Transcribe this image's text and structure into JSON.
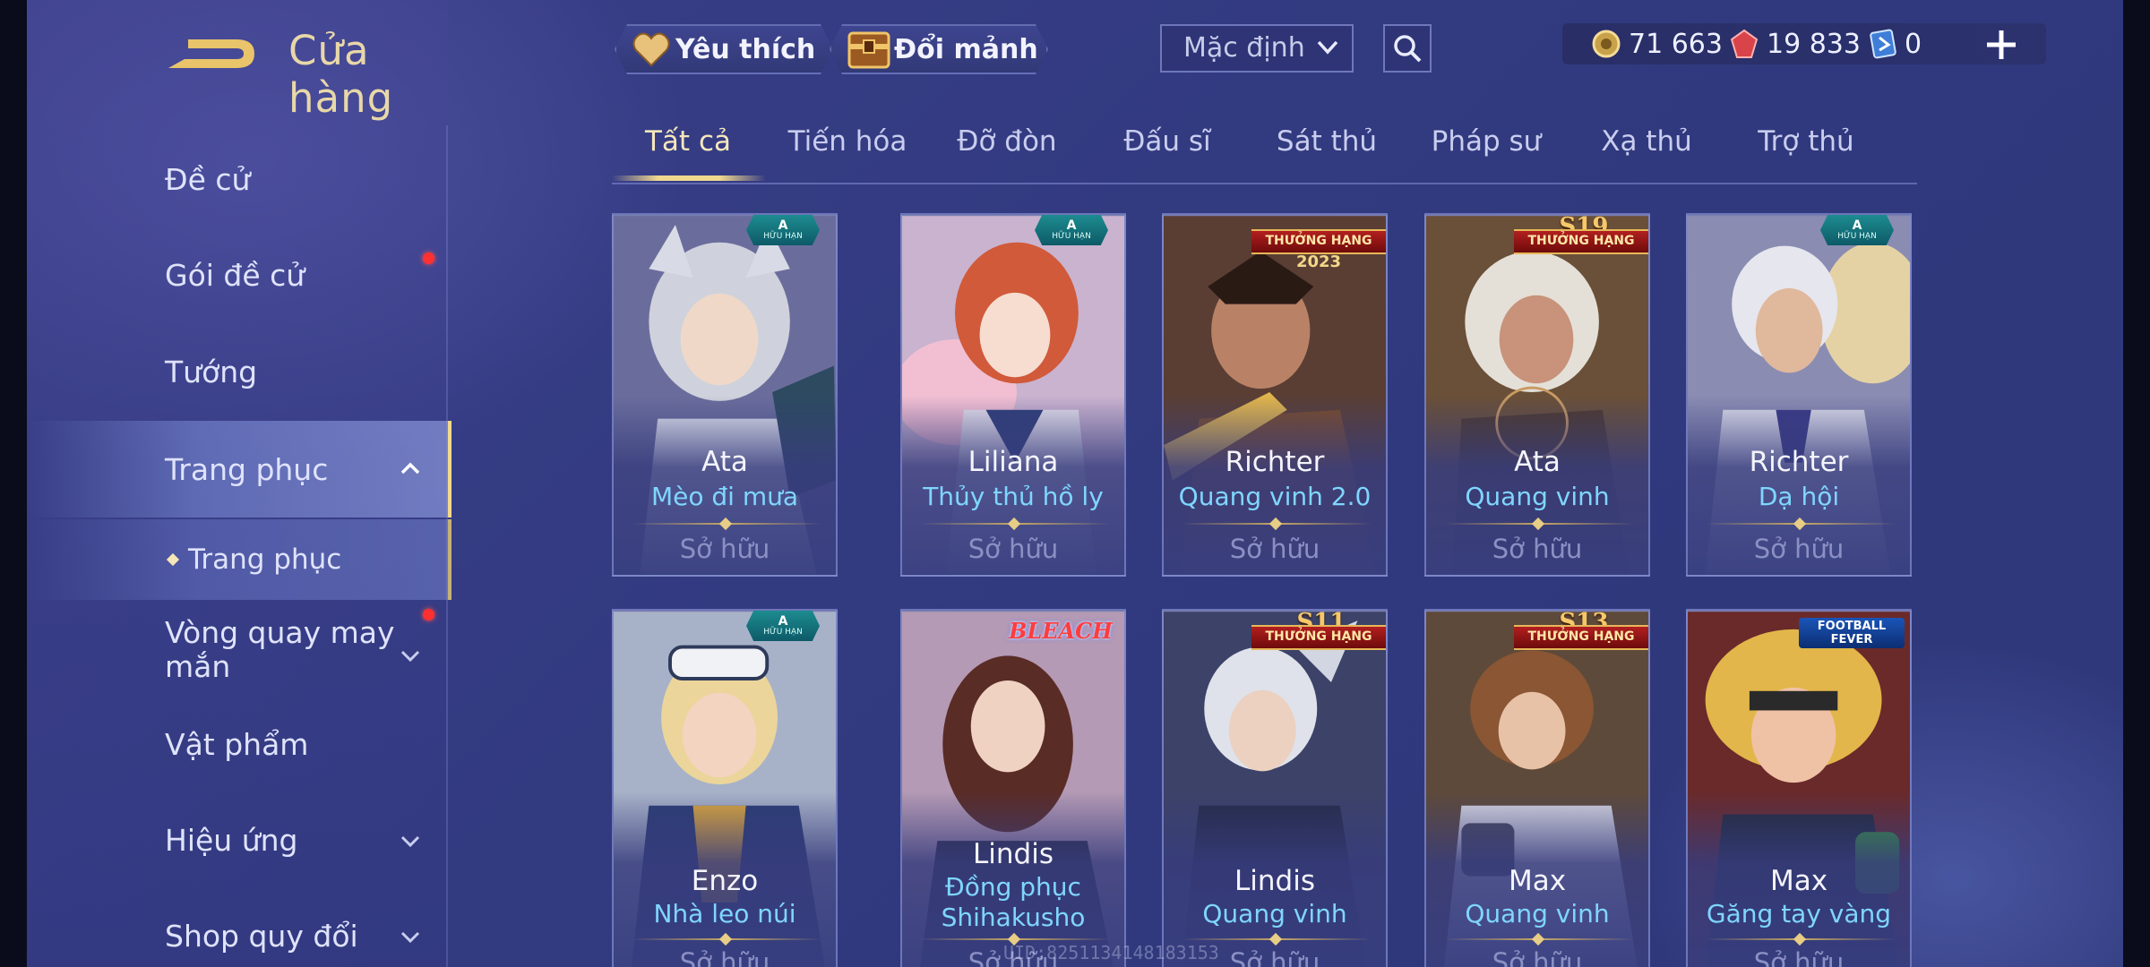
{
  "header": {
    "title": "Cửa hàng",
    "favorite_label": "Yêu thích",
    "exchange_label": "Đổi mảnh",
    "sort_value": "Mặc định"
  },
  "currency": {
    "gold": "71 663",
    "gems": "19 833",
    "vouchers": "0"
  },
  "sidebar": {
    "items": [
      {
        "label": "Đề cử"
      },
      {
        "label": "Gói đề cử"
      },
      {
        "label": "Tướng"
      },
      {
        "label": "Trang phục"
      },
      {
        "label": "Trang phục"
      },
      {
        "label": "Vòng quay may mắn"
      },
      {
        "label": "Vật phẩm"
      },
      {
        "label": "Hiệu ứng"
      },
      {
        "label": "Shop quy đổi"
      }
    ]
  },
  "tabs": [
    "Tất cả",
    "Tiến hóa",
    "Đỡ đòn",
    "Đấu sĩ",
    "Sát thủ",
    "Pháp sư",
    "Xạ thủ",
    "Trợ thủ"
  ],
  "owned_label": "Sở hữu",
  "badges": {
    "limited_grade": "A",
    "limited_text": "HỮU HẠN",
    "rank_text": "THƯỞNG HẠNG",
    "s19": "S19",
    "s11": "S11",
    "s13": "S13",
    "year_2023": "2023",
    "bleach": "BLEACH",
    "football": "FOOTBALL FEVER"
  },
  "cards": [
    {
      "hero": "Ata",
      "skin": "Mèo đi mưa"
    },
    {
      "hero": "Liliana",
      "skin": "Thủy thủ hồ ly"
    },
    {
      "hero": "Richter",
      "skin": "Quang vinh 2.0"
    },
    {
      "hero": "Ata",
      "skin": "Quang vinh"
    },
    {
      "hero": "Richter",
      "skin": "Dạ hội"
    },
    {
      "hero": "Enzo",
      "skin": "Nhà leo núi"
    },
    {
      "hero": "Lindis",
      "skin": "Đồng phục Shihakusho"
    },
    {
      "hero": "Lindis",
      "skin": "Quang vinh"
    },
    {
      "hero": "Max",
      "skin": "Quang vinh"
    },
    {
      "hero": "Max",
      "skin": "Găng tay vàng"
    }
  ],
  "watermark": "UID:8251134148183153",
  "colors": {
    "accent_gold": "#f0d88e",
    "skin_name_blue": "#7fd6ff",
    "notification_red": "#ff3030"
  }
}
